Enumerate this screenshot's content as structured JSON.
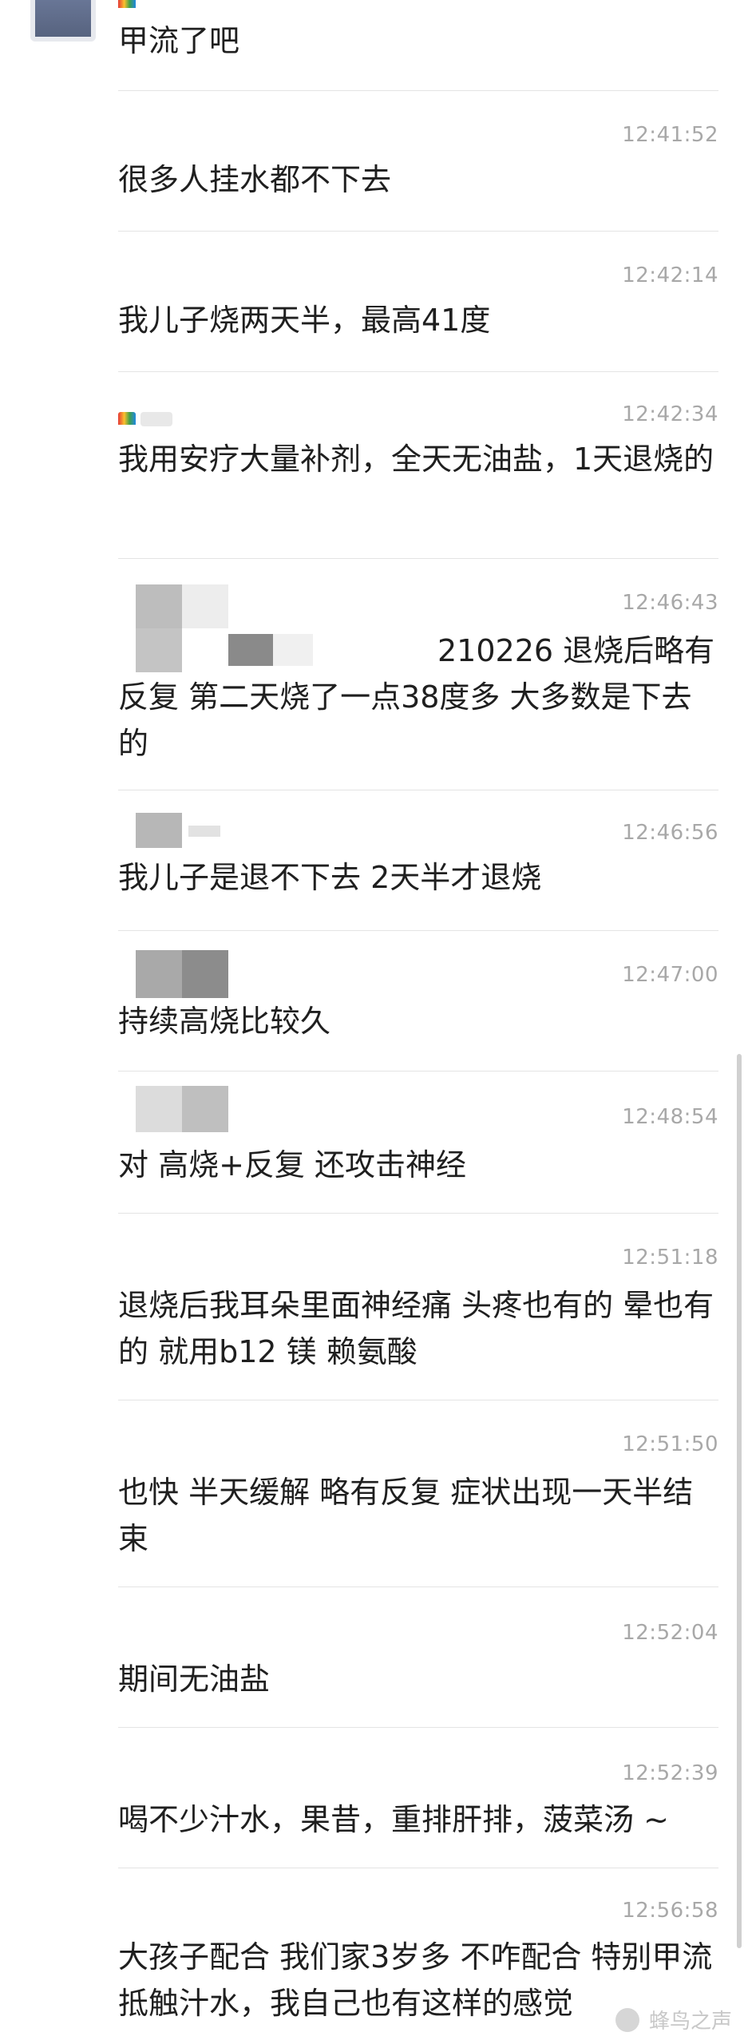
{
  "messages": [
    {
      "time": "",
      "text": "甲流了吧"
    },
    {
      "time": "12:41:52",
      "text": "很多人挂水都不下去"
    },
    {
      "time": "12:42:14",
      "text": "我儿子烧两天半，最高41度"
    },
    {
      "time": "12:42:34",
      "text": "我用安疗大量补剂，全天无油盐，1天退烧的"
    },
    {
      "time": "12:46:43",
      "text": "210226 退烧后略有反复 第二天烧了一点38度多 大多数是下去的"
    },
    {
      "time": "12:46:56",
      "text": "我儿子是退不下去 2天半才退烧"
    },
    {
      "time": "12:47:00",
      "text": "持续高烧比较久"
    },
    {
      "time": "12:48:54",
      "text": "对 高烧+反复 还攻击神经"
    },
    {
      "time": "12:51:18",
      "text": "退烧后我耳朵里面神经痛 头疼也有的 晕也有的 就用b12 镁 赖氨酸"
    },
    {
      "time": "12:51:50",
      "text": "也快 半天缓解 略有反复 症状出现一天半结束"
    },
    {
      "time": "12:52:04",
      "text": "期间无油盐"
    },
    {
      "time": "12:52:39",
      "text": "喝不少汁水，果昔，重排肝排，菠菜汤 ~"
    },
    {
      "time": "12:56:58",
      "text": "大孩子配合 我们家3岁多 不咋配合 特别甲流 抵触汁水，我自己也有这样的感觉"
    }
  ],
  "watermark": {
    "text": "蜂鸟之声"
  },
  "colors": {
    "time": "#a8a8a8",
    "text": "#1f1f1f",
    "divider": "#e4e4e4"
  }
}
